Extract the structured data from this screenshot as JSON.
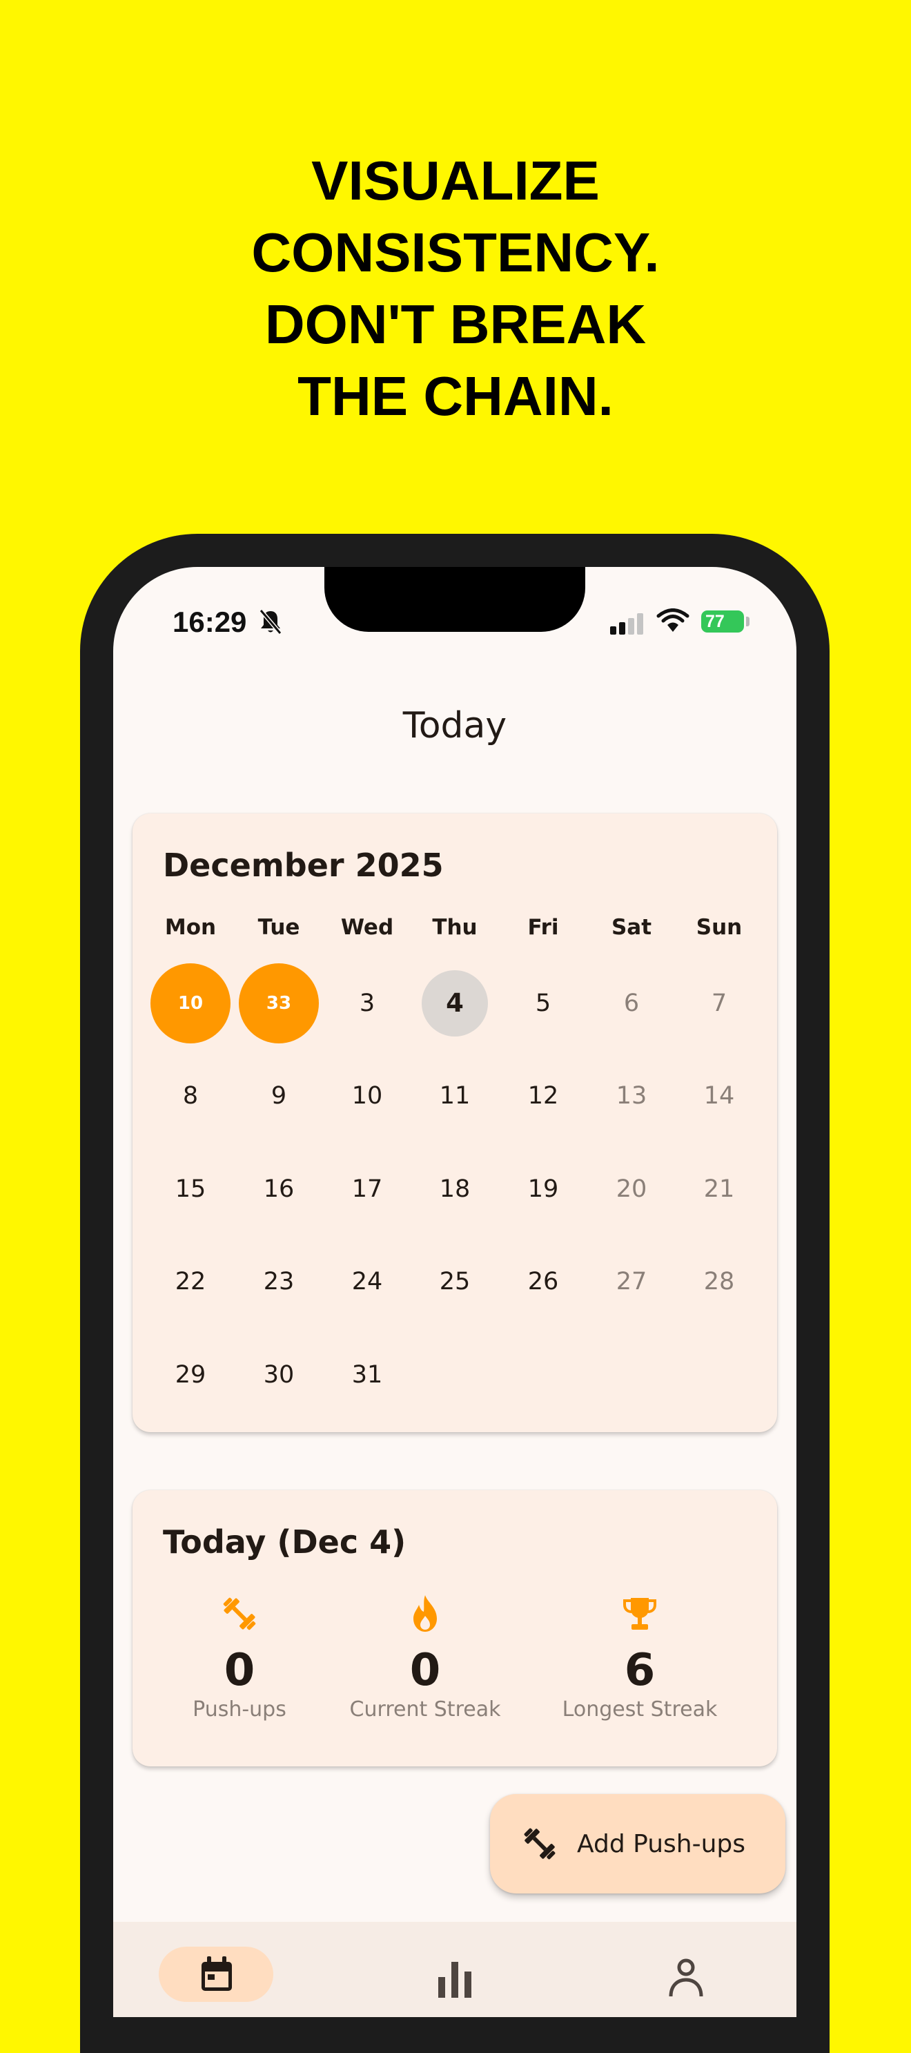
{
  "headline": [
    "VISUALIZE",
    "CONSISTENCY.",
    "DON'T BREAK",
    "THE CHAIN."
  ],
  "status_bar": {
    "time": "16:29",
    "battery": "77"
  },
  "page_title": "Today",
  "calendar": {
    "title": "December 2025",
    "weekdays": [
      "Mon",
      "Tue",
      "Wed",
      "Thu",
      "Fri",
      "Sat",
      "Sun"
    ],
    "rows": [
      [
        "10",
        "33",
        "3",
        "4",
        "5",
        "6",
        "7"
      ],
      [
        "8",
        "9",
        "10",
        "11",
        "12",
        "13",
        "14"
      ],
      [
        "15",
        "16",
        "17",
        "18",
        "19",
        "20",
        "21"
      ],
      [
        "22",
        "23",
        "24",
        "25",
        "26",
        "27",
        "28"
      ],
      [
        "29",
        "30",
        "31",
        "",
        "",
        "",
        ""
      ]
    ],
    "completed_days": [
      {
        "date": "Dec 1",
        "pushups": "10"
      },
      {
        "date": "Dec 2",
        "pushups": "33"
      }
    ],
    "today": "4"
  },
  "today_card": {
    "title": "Today (Dec 4)",
    "stats": [
      {
        "icon": "dumbbell-icon",
        "value": "0",
        "label": "Push-ups"
      },
      {
        "icon": "flame-icon",
        "value": "0",
        "label": "Current Streak"
      },
      {
        "icon": "trophy-icon",
        "value": "6",
        "label": "Longest Streak"
      }
    ]
  },
  "fab": {
    "label": "Add Push-ups",
    "icon": "dumbbell-icon"
  },
  "bottom_nav": {
    "items": [
      {
        "icon": "calendar-icon",
        "selected": true
      },
      {
        "icon": "bar-chart-icon",
        "selected": false
      },
      {
        "icon": "person-icon",
        "selected": false
      }
    ]
  },
  "colors": {
    "background": "#FFF700",
    "accent": "#FF9800",
    "card": "#FDEFE6",
    "fab": "#FFDDC0"
  }
}
